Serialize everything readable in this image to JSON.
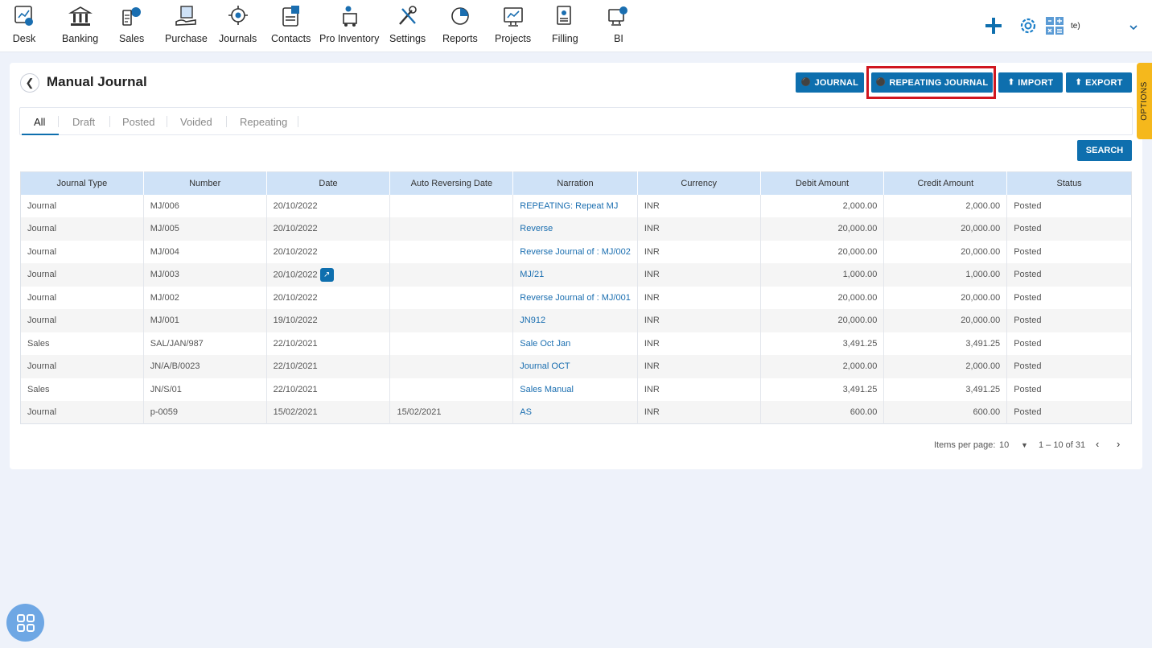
{
  "nav": {
    "items": [
      {
        "label": "Desk",
        "icon": "desk-icon"
      },
      {
        "label": "Banking",
        "icon": "bank-icon"
      },
      {
        "label": "Sales",
        "icon": "sales-icon"
      },
      {
        "label": "Purchase",
        "icon": "purchase-icon"
      },
      {
        "label": "Journals",
        "icon": "journals-icon"
      },
      {
        "label": "Contacts",
        "icon": "contacts-icon"
      },
      {
        "label": "Pro Inventory",
        "icon": "inventory-icon"
      },
      {
        "label": "Settings",
        "icon": "settings-icon"
      },
      {
        "label": "Reports",
        "icon": "reports-icon"
      },
      {
        "label": "Projects",
        "icon": "projects-icon"
      },
      {
        "label": "Filling",
        "icon": "filling-icon"
      },
      {
        "label": "BI",
        "icon": "bi-icon"
      }
    ],
    "company_text": "te)"
  },
  "page": {
    "title": "Manual Journal",
    "buttons": {
      "journal": "JOURNAL",
      "repeating_journal": "REPEATING JOURNAL",
      "import": "IMPORT",
      "export": "EXPORT",
      "search": "SEARCH"
    },
    "tabs": [
      "All",
      "Draft",
      "Posted",
      "Voided",
      "Repeating"
    ],
    "options_label": "OPTIONS"
  },
  "table": {
    "columns": [
      "Journal Type",
      "Number",
      "Date",
      "Auto Reversing Date",
      "Narration",
      "Currency",
      "Debit Amount",
      "Credit Amount",
      "Status"
    ],
    "rows": [
      [
        "Journal",
        "MJ/006",
        "20/10/2022",
        "",
        "REPEATING: Repeat MJ",
        "INR",
        "2,000.00",
        "2,000.00",
        "Posted"
      ],
      [
        "Journal",
        "MJ/005",
        "20/10/2022",
        "",
        "Reverse",
        "INR",
        "20,000.00",
        "20,000.00",
        "Posted"
      ],
      [
        "Journal",
        "MJ/004",
        "20/10/2022",
        "",
        "Reverse Journal of : MJ/002",
        "INR",
        "20,000.00",
        "20,000.00",
        "Posted"
      ],
      [
        "Journal",
        "MJ/003",
        "20/10/2022",
        "",
        "MJ/21",
        "INR",
        "1,000.00",
        "1,000.00",
        "Posted"
      ],
      [
        "Journal",
        "MJ/002",
        "20/10/2022",
        "",
        "Reverse Journal of : MJ/001",
        "INR",
        "20,000.00",
        "20,000.00",
        "Posted"
      ],
      [
        "Journal",
        "MJ/001",
        "19/10/2022",
        "",
        "JN912",
        "INR",
        "20,000.00",
        "20,000.00",
        "Posted"
      ],
      [
        "Sales",
        "SAL/JAN/987",
        "22/10/2021",
        "",
        "Sale Oct Jan",
        "INR",
        "3,491.25",
        "3,491.25",
        "Posted"
      ],
      [
        "Journal",
        "JN/A/B/0023",
        "22/10/2021",
        "",
        "Journal OCT",
        "INR",
        "2,000.00",
        "2,000.00",
        "Posted"
      ],
      [
        "Sales",
        "JN/S/01",
        "22/10/2021",
        "",
        "Sales Manual",
        "INR",
        "3,491.25",
        "3,491.25",
        "Posted"
      ],
      [
        "Journal",
        "p-0059",
        "15/02/2021",
        "15/02/2021",
        "AS",
        "INR",
        "600.00",
        "600.00",
        "Posted"
      ]
    ]
  },
  "pager": {
    "items_label": "Items per page:",
    "per_page": "10",
    "range": "1 – 10 of 31"
  }
}
